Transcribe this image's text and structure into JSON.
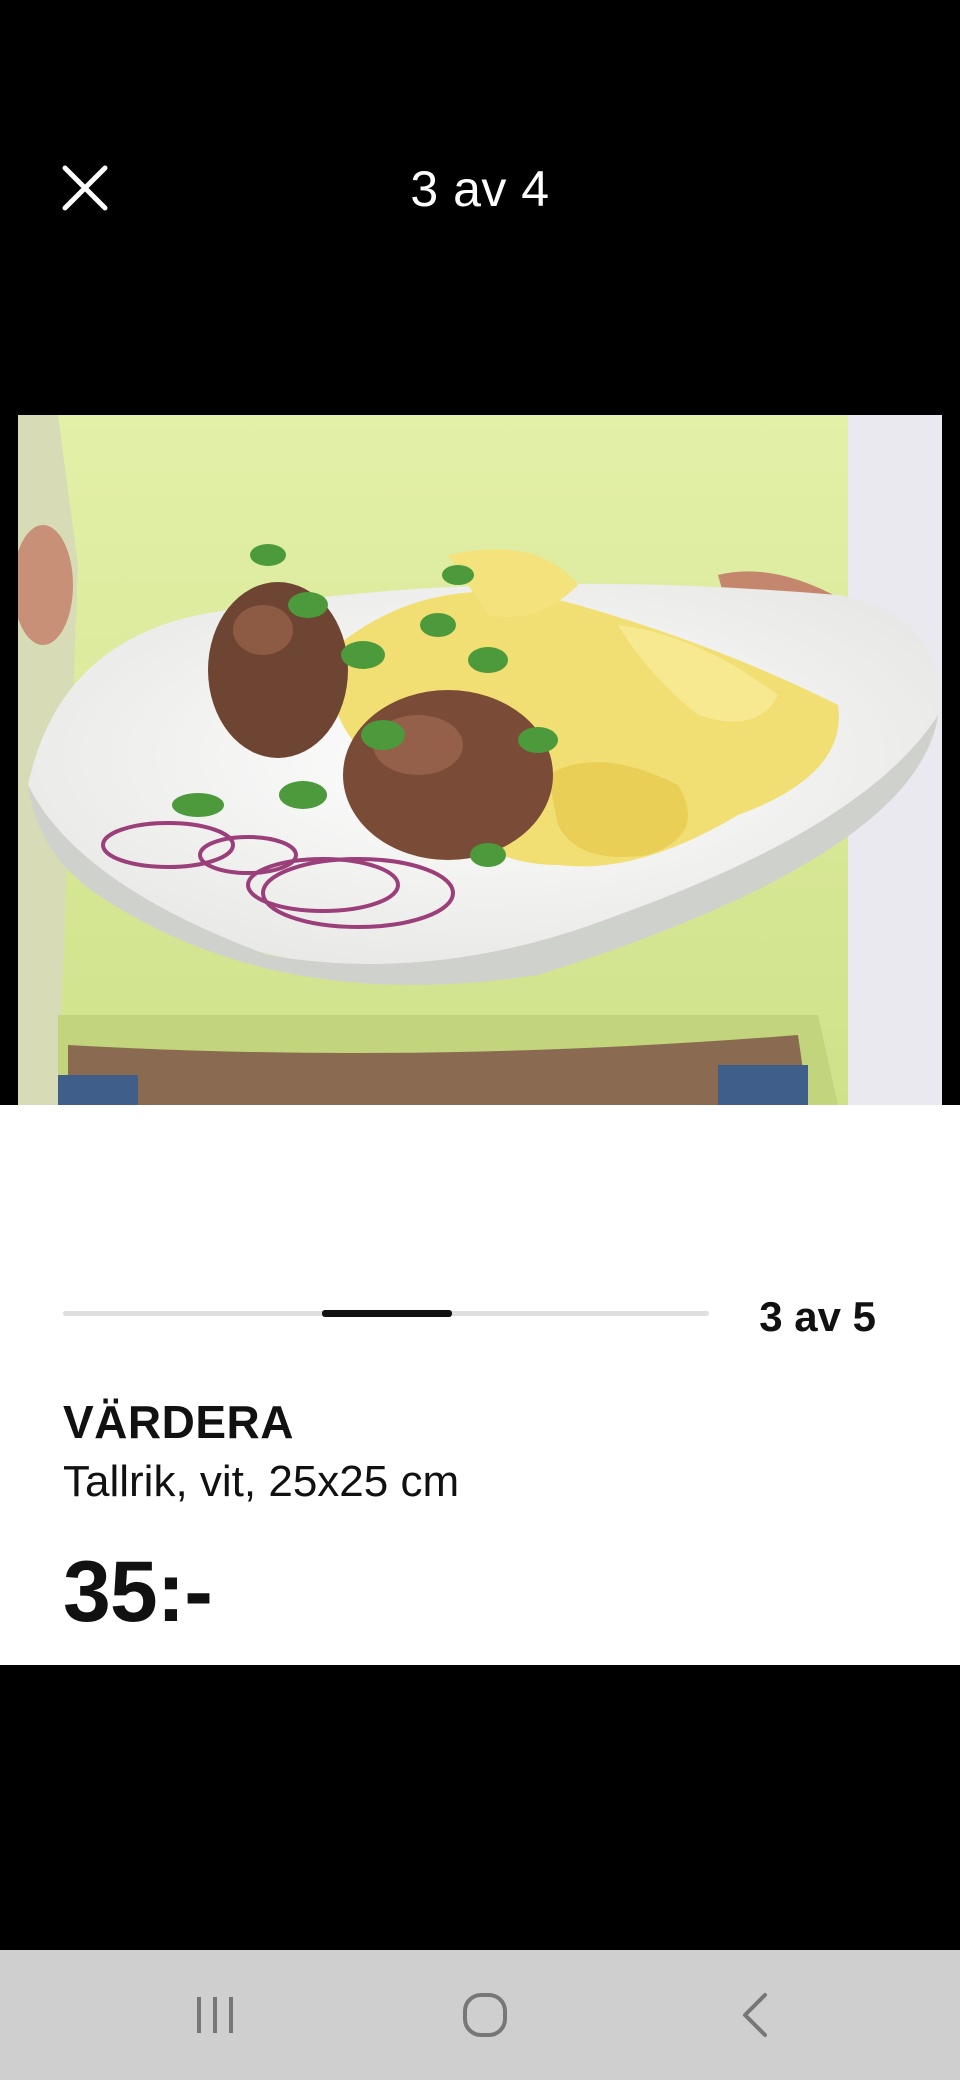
{
  "viewer": {
    "counter": "3 av 4"
  },
  "product": {
    "slide_count": "3 av 5",
    "progress": 0.5,
    "name": "VÄRDERA",
    "description": "Tallrik, vit, 25x25 cm",
    "price": "35:-"
  },
  "icons": {
    "close": "close-icon",
    "recents": "recent-apps-icon",
    "home": "home-icon",
    "back": "back-icon"
  },
  "colors": {
    "background": "#000000",
    "card": "#ffffff",
    "text": "#111111",
    "navbar": "#cfcfcf"
  }
}
